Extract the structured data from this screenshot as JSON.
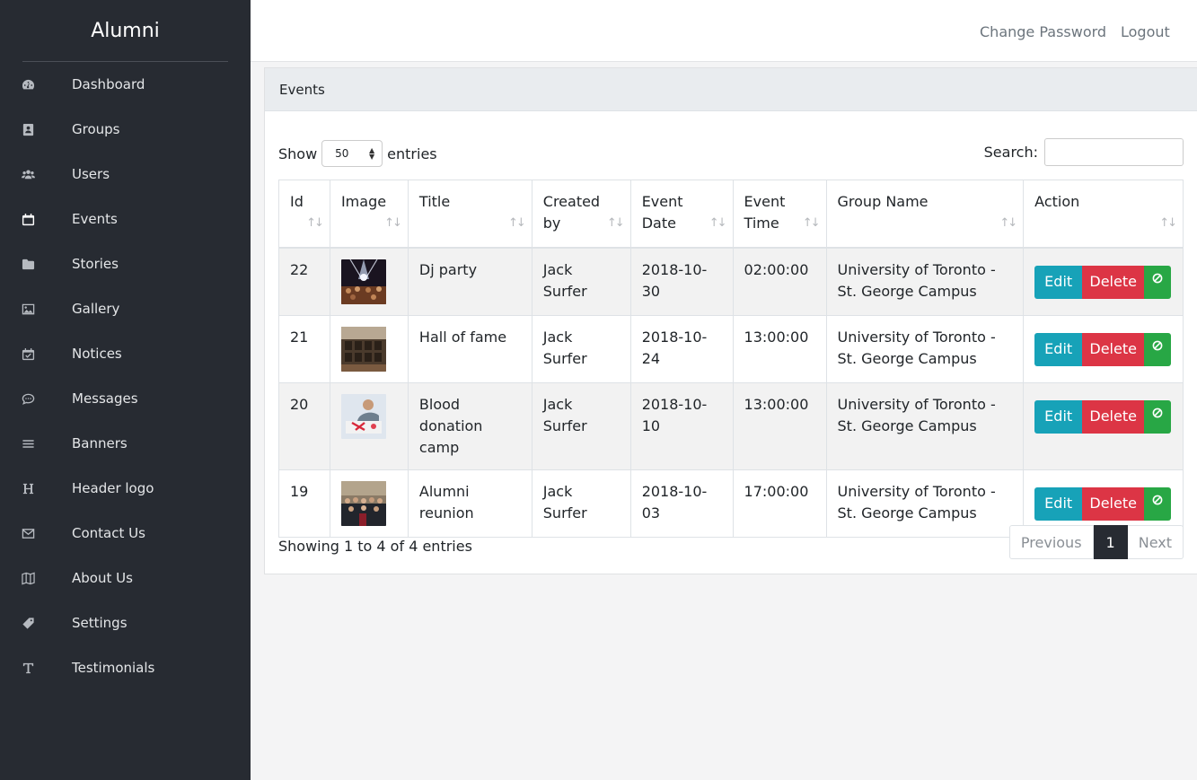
{
  "app": {
    "title": "Alumni"
  },
  "sidebar": {
    "items": [
      {
        "label": "Dashboard",
        "icon": "dashboard-icon"
      },
      {
        "label": "Groups",
        "icon": "address-book-icon"
      },
      {
        "label": "Users",
        "icon": "users-icon"
      },
      {
        "label": "Events",
        "icon": "calendar-icon"
      },
      {
        "label": "Stories",
        "icon": "folder-icon"
      },
      {
        "label": "Gallery",
        "icon": "image-icon"
      },
      {
        "label": "Notices",
        "icon": "calendar-check-icon"
      },
      {
        "label": "Messages",
        "icon": "comment-icon"
      },
      {
        "label": "Banners",
        "icon": "bars-icon"
      },
      {
        "label": "Header logo",
        "icon": "heading-icon"
      },
      {
        "label": "Contact Us",
        "icon": "envelope-icon"
      },
      {
        "label": "About Us",
        "icon": "map-icon"
      },
      {
        "label": "Settings",
        "icon": "tag-icon"
      },
      {
        "label": "Testimonials",
        "icon": "text-icon"
      }
    ]
  },
  "topbar": {
    "change_password": "Change Password",
    "logout": "Logout"
  },
  "card": {
    "title": "Events"
  },
  "controls": {
    "show_label": "Show",
    "entries_label": "entries",
    "page_size": "50",
    "search_label": "Search:",
    "search_value": ""
  },
  "table": {
    "columns": [
      {
        "line1": "Id",
        "line2": ""
      },
      {
        "line1": "Image",
        "line2": ""
      },
      {
        "line1": "Title",
        "line2": ""
      },
      {
        "line1": "Created",
        "line2": "by"
      },
      {
        "line1": "Event",
        "line2": "Date"
      },
      {
        "line1": "Event",
        "line2": "Time"
      },
      {
        "line1": "Group Name",
        "line2": ""
      },
      {
        "line1": "Action",
        "line2": ""
      }
    ],
    "rows": [
      {
        "id": "22",
        "title": "Dj party",
        "created_by": "Jack Surfer",
        "date": "2018-10-30",
        "time": "02:00:00",
        "group": "University of Toronto - St. George Campus"
      },
      {
        "id": "21",
        "title": "Hall of fame",
        "created_by": "Jack Surfer",
        "date": "2018-10-24",
        "time": "13:00:00",
        "group": "University of Toronto - St. George Campus"
      },
      {
        "id": "20",
        "title": "Blood donation camp",
        "created_by": "Jack Surfer",
        "date": "2018-10-10",
        "time": "13:00:00",
        "group": "University of Toronto - St. George Campus"
      },
      {
        "id": "19",
        "title": "Alumni reunion",
        "created_by": "Jack Surfer",
        "date": "2018-10-03",
        "time": "17:00:00",
        "group": "University of Toronto - St. George Campus"
      }
    ],
    "actions": {
      "edit": "Edit",
      "delete": "Delete"
    }
  },
  "footer": {
    "info": "Showing 1 to 4 of 4 entries",
    "previous": "Previous",
    "current_page": "1",
    "next": "Next"
  },
  "colors": {
    "sidebar_bg": "#272b32",
    "edit": "#17a2b8",
    "delete": "#dc3545",
    "disable": "#28a745"
  }
}
